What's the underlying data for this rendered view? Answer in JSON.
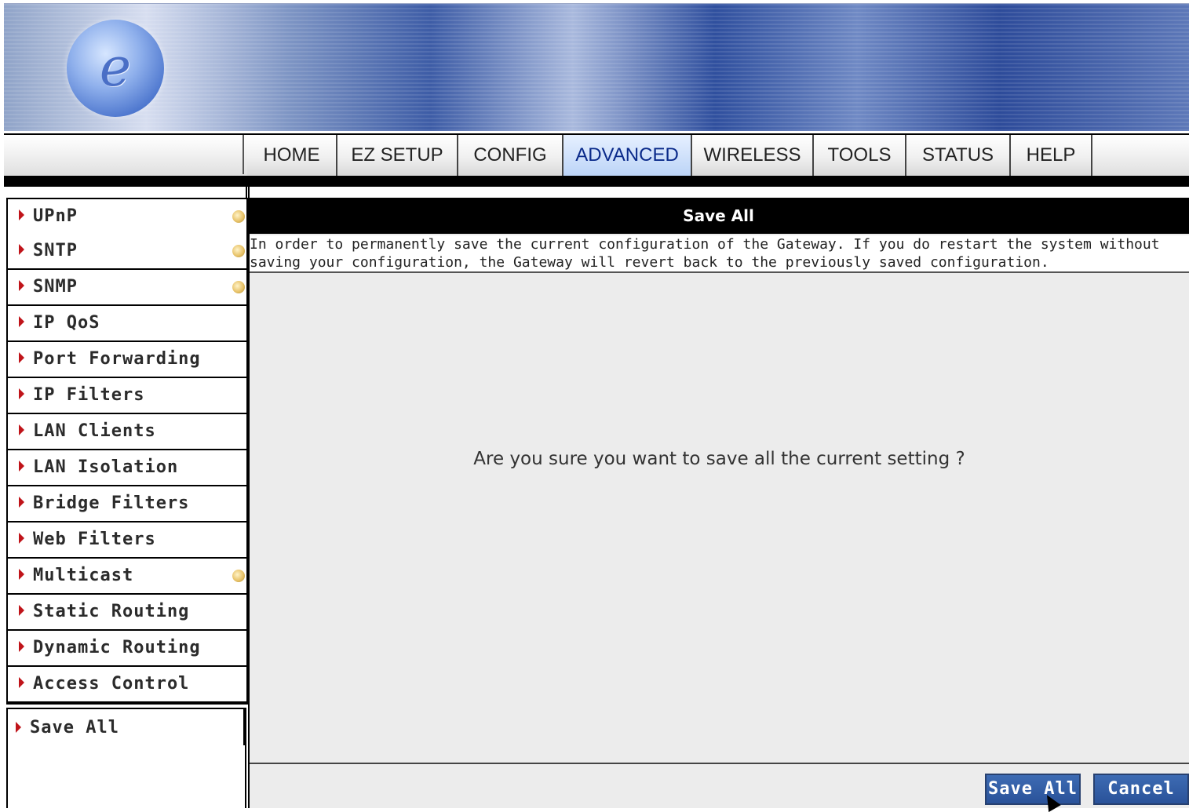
{
  "header": {
    "logo_letter": "e"
  },
  "nav": {
    "tabs": [
      {
        "label": "HOME",
        "active": false
      },
      {
        "label": "EZ SETUP",
        "active": false
      },
      {
        "label": "CONFIG",
        "active": false
      },
      {
        "label": "ADVANCED",
        "active": true
      },
      {
        "label": "WIRELESS",
        "active": false
      },
      {
        "label": "TOOLS",
        "active": false
      },
      {
        "label": "STATUS",
        "active": false
      },
      {
        "label": "HELP",
        "active": false
      }
    ]
  },
  "sidebar": {
    "items": [
      {
        "label": "UPnP",
        "bullet": true
      },
      {
        "label": "SNTP",
        "bullet": true
      },
      {
        "label": "SNMP",
        "bullet": true
      },
      {
        "label": "IP QoS",
        "bullet": false
      },
      {
        "label": "Port Forwarding",
        "bullet": false
      },
      {
        "label": "IP Filters",
        "bullet": false
      },
      {
        "label": "LAN Clients",
        "bullet": false
      },
      {
        "label": "LAN Isolation",
        "bullet": false
      },
      {
        "label": "Bridge Filters",
        "bullet": false
      },
      {
        "label": "Web Filters",
        "bullet": false
      },
      {
        "label": "Multicast",
        "bullet": true
      },
      {
        "label": "Static Routing",
        "bullet": false
      },
      {
        "label": "Dynamic Routing",
        "bullet": false
      },
      {
        "label": "Access Control",
        "bullet": false
      }
    ],
    "save_all": "Save All"
  },
  "content": {
    "title": "Save All",
    "description_line1": "In order to permanently save the current configuration of the Gateway. If you do restart the system without",
    "description_line2": "saving your configuration, the Gateway will revert back to the previously saved configuration.",
    "question": "Are you sure you want to save all the current setting ?"
  },
  "buttons": {
    "save_all": "Save All",
    "cancel": "Cancel"
  },
  "colors": {
    "accent": "#2a5299",
    "arrow": "#c0141a"
  }
}
